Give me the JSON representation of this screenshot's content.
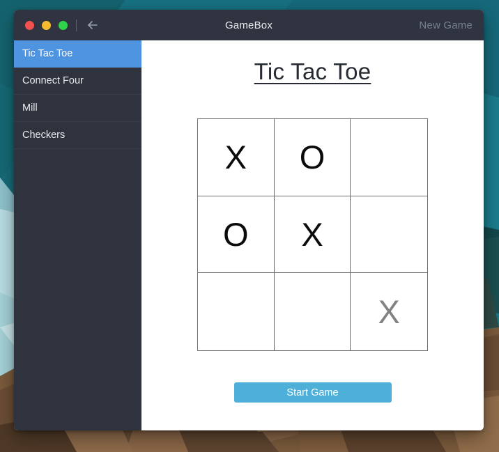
{
  "window": {
    "title": "GameBox",
    "new_game_label": "New Game",
    "back_icon": "back-arrow-icon",
    "controls": {
      "close_color": "#f2524f",
      "minimize_color": "#f6bb2e",
      "maximize_color": "#2fd44a"
    }
  },
  "sidebar": {
    "items": [
      {
        "label": "Tic Tac Toe",
        "active": true
      },
      {
        "label": "Connect Four",
        "active": false
      },
      {
        "label": "Mill",
        "active": false
      },
      {
        "label": "Checkers",
        "active": false
      }
    ],
    "active_color": "#4f94e0",
    "background_color": "#2e333d"
  },
  "main": {
    "title": "Tic Tac Toe",
    "start_button_label": "Start Game",
    "start_button_color": "#4eb0d9",
    "board": {
      "rows": 3,
      "columns": 3,
      "cells": [
        {
          "mark": "X",
          "state": "placed"
        },
        {
          "mark": "O",
          "state": "placed"
        },
        {
          "mark": "",
          "state": "empty"
        },
        {
          "mark": "O",
          "state": "placed"
        },
        {
          "mark": "X",
          "state": "placed"
        },
        {
          "mark": "",
          "state": "empty"
        },
        {
          "mark": "",
          "state": "empty"
        },
        {
          "mark": "",
          "state": "empty"
        },
        {
          "mark": "X",
          "state": "preview"
        }
      ],
      "mark_color": "#0b0b0b",
      "preview_color": "#828282",
      "line_color": "#6d6d6d"
    }
  }
}
